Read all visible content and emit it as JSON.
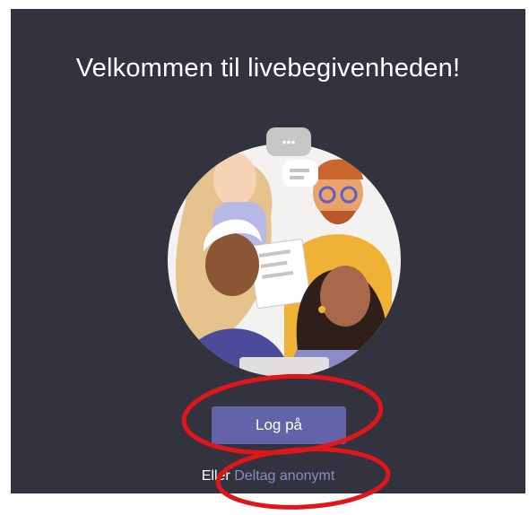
{
  "welcome": {
    "title": "Velkommen til livebegivenheden!"
  },
  "illustration": {
    "icon": "people-group-illustration",
    "speech_bubble_text": "•••"
  },
  "actions": {
    "signin_label": "Log på",
    "alt_prefix": "Eller",
    "anonymous_label": "Deltag anonymt"
  },
  "colors": {
    "background": "#33323f",
    "primary_button": "#6264a7",
    "link": "#8b8cc7",
    "annotation": "#e0161b"
  }
}
